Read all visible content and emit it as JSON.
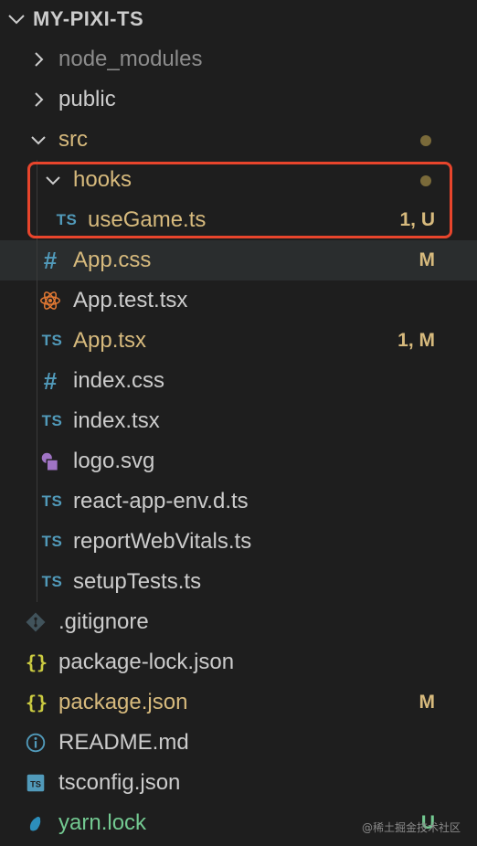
{
  "explorer": {
    "root_title": "MY-PIXI-TS",
    "items": [
      {
        "label": "node_modules",
        "type": "folder",
        "icon": "chevron-right-icon",
        "status": "",
        "color": "#8c8c8c"
      },
      {
        "label": "public",
        "type": "folder",
        "icon": "chevron-right-icon",
        "status": "",
        "color": "#cccccc"
      },
      {
        "label": "src",
        "type": "folder",
        "icon": "chevron-down-icon",
        "status": "",
        "color": "#d7ba7d"
      },
      {
        "label": "hooks",
        "type": "folder",
        "icon": "chevron-down-icon",
        "status": "",
        "color": "#d7ba7d"
      },
      {
        "label": "useGame.ts",
        "type": "file",
        "icon": "typescript-icon",
        "status": "1, U",
        "color": "#d7ba7d"
      },
      {
        "label": "App.css",
        "type": "file",
        "icon": "css-hash-icon",
        "status": "M",
        "color": "#d7ba7d"
      },
      {
        "label": "App.test.tsx",
        "type": "file",
        "icon": "react-icon",
        "status": "",
        "color": "#cccccc"
      },
      {
        "label": "App.tsx",
        "type": "file",
        "icon": "typescript-icon",
        "status": "1, M",
        "color": "#d7ba7d"
      },
      {
        "label": "index.css",
        "type": "file",
        "icon": "css-hash-icon",
        "status": "",
        "color": "#cccccc"
      },
      {
        "label": "index.tsx",
        "type": "file",
        "icon": "typescript-icon",
        "status": "",
        "color": "#cccccc"
      },
      {
        "label": "logo.svg",
        "type": "file",
        "icon": "svg-image-icon",
        "status": "",
        "color": "#cccccc"
      },
      {
        "label": "react-app-env.d.ts",
        "type": "file",
        "icon": "typescript-icon",
        "status": "",
        "color": "#cccccc"
      },
      {
        "label": "reportWebVitals.ts",
        "type": "file",
        "icon": "typescript-icon",
        "status": "",
        "color": "#cccccc"
      },
      {
        "label": "setupTests.ts",
        "type": "file",
        "icon": "typescript-icon",
        "status": "",
        "color": "#cccccc"
      },
      {
        "label": ".gitignore",
        "type": "file",
        "icon": "git-icon",
        "status": "",
        "color": "#cccccc"
      },
      {
        "label": "package-lock.json",
        "type": "file",
        "icon": "json-braces-icon",
        "status": "",
        "color": "#cccccc"
      },
      {
        "label": "package.json",
        "type": "file",
        "icon": "json-braces-icon",
        "status": "M",
        "color": "#d7ba7d"
      },
      {
        "label": "README.md",
        "type": "file",
        "icon": "info-icon",
        "status": "",
        "color": "#cccccc"
      },
      {
        "label": "tsconfig.json",
        "type": "file",
        "icon": "tsconfig-icon",
        "status": "",
        "color": "#cccccc"
      },
      {
        "label": "yarn.lock",
        "type": "file",
        "icon": "yarn-icon",
        "status": "U",
        "color": "#73c991"
      }
    ]
  },
  "watermark": "@稀土掘金技术社区",
  "colors": {
    "modified": "#d7ba7d",
    "untracked": "#73c991",
    "dot": "#7a6a3a",
    "highlight": "#e8452c",
    "ts_blue": "#519aba"
  }
}
